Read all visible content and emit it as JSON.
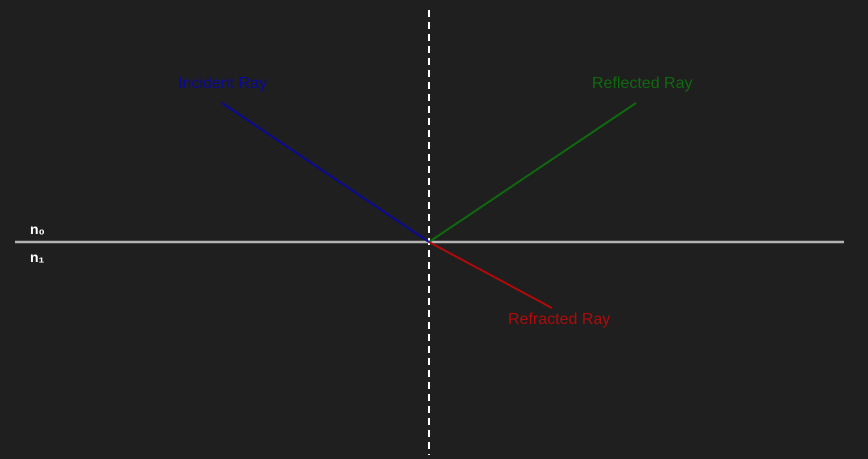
{
  "colors": {
    "background": "#1f1f1f",
    "interface": "#b3b3b3",
    "normal": "#ffffff",
    "incident": "#0a0a96",
    "reflected": "#0f6a0f",
    "refracted": "#b00a0a",
    "medium_label": "#ffffff"
  },
  "labels": {
    "incident": "Incident Ray",
    "reflected": "Reflected Ray",
    "refracted": "Refracted Ray",
    "n0": "n₀",
    "n1": "n₁"
  }
}
